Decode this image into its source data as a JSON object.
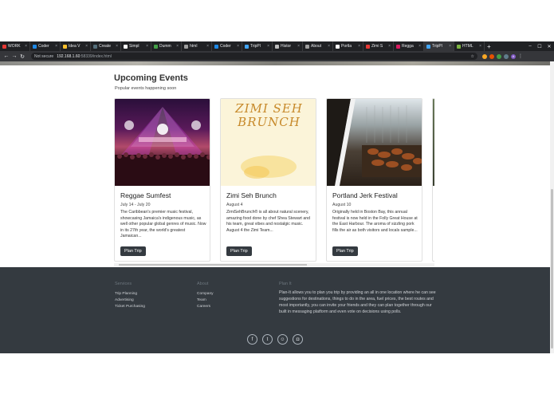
{
  "browser": {
    "tabs": [
      {
        "label": "WORK",
        "color": "#e53935",
        "active": false
      },
      {
        "label": "Coder",
        "color": "#1e88e5",
        "active": false
      },
      {
        "label": "Idea V",
        "color": "#fbc02d",
        "active": false
      },
      {
        "label": "Create",
        "color": "#546e7a",
        "active": false
      },
      {
        "label": "Simpl",
        "color": "#ffffff",
        "active": false
      },
      {
        "label": "Dumm",
        "color": "#43a047",
        "active": false
      },
      {
        "label": "html",
        "color": "#9e9e9e",
        "active": false
      },
      {
        "label": "Coder",
        "color": "#1e88e5",
        "active": false
      },
      {
        "label": "TripPl",
        "color": "#42a5f5",
        "active": false
      },
      {
        "label": "Histor",
        "color": "#bdbdbd",
        "active": false
      },
      {
        "label": "About",
        "color": "#9e9e9e",
        "active": false
      },
      {
        "label": "Portla",
        "color": "#ffffff",
        "active": false
      },
      {
        "label": "Zimi S",
        "color": "#e53935",
        "active": false
      },
      {
        "label": "Regga",
        "color": "#d81b60",
        "active": false
      },
      {
        "label": "TripPl",
        "color": "#42a5f5",
        "active": true
      },
      {
        "label": "HTML",
        "color": "#7cb342",
        "active": false
      }
    ],
    "new_tab": "+",
    "win_min": "–",
    "win_max": "☐",
    "win_close": "✕",
    "back": "←",
    "forward": "→",
    "reload": "↻",
    "secure_label": "Not secure",
    "url_host": "192.168.1.60",
    "url_path": ":58339/index.html",
    "star": "☆",
    "profile_initial": "A",
    "menu": "⋮"
  },
  "events": {
    "title": "Upcoming Events",
    "subtitle": "Popular events happening soon",
    "cards": [
      {
        "title": "Reggae Sumfest",
        "date": "July 14 - July 20",
        "description": "The Caribbean's premier music festival, showcasing Jamaica's indigenous music, as well other popular global genres of music. Now in its 27th year, the world's greatest Jamaican...",
        "button": "Plan Trip"
      },
      {
        "title": "Zimi Seh Brunch",
        "date": "August 4",
        "description": "ZimiSehBrunch® is all about natural scenery, amazing food done by chef Shea Stewart and his team, great vibes and nostalgic music. August 4 the Zimi Team...",
        "button": "Plan Trip",
        "art_text": "ZIMI SEH BRUNCH"
      },
      {
        "title": "Portland Jerk Festival",
        "date": "August 10",
        "description": "Originally held in Boston Bay, this annual festival is now held in the Folly Great House at the East Harbour. The aroma of sizzling pork fills the air as both visitors and locals sample...",
        "button": "Plan Trip"
      }
    ]
  },
  "footer": {
    "services": {
      "title": "Services",
      "links": [
        "Trip Planning",
        "Advertising",
        "Ticket Purchasing"
      ]
    },
    "about": {
      "title": "About",
      "links": [
        "Company",
        "Team",
        "Careers"
      ]
    },
    "plan_it": {
      "title": "Plan It",
      "text": "Plan-It allows you to plan you trip by providing an all in one location where he can see suggestions for destinations, things to do in the area, fuel prices, the best routes and most importantly, you can invite your friends and they can plan together through our built in messaging platform and even vote on decisions using polls."
    },
    "social": [
      {
        "icon": "facebook-icon",
        "glyph": "f"
      },
      {
        "icon": "twitter-icon",
        "glyph": "t"
      },
      {
        "icon": "snapchat-icon",
        "glyph": "☺"
      },
      {
        "icon": "instagram-icon",
        "glyph": "◘"
      }
    ]
  }
}
